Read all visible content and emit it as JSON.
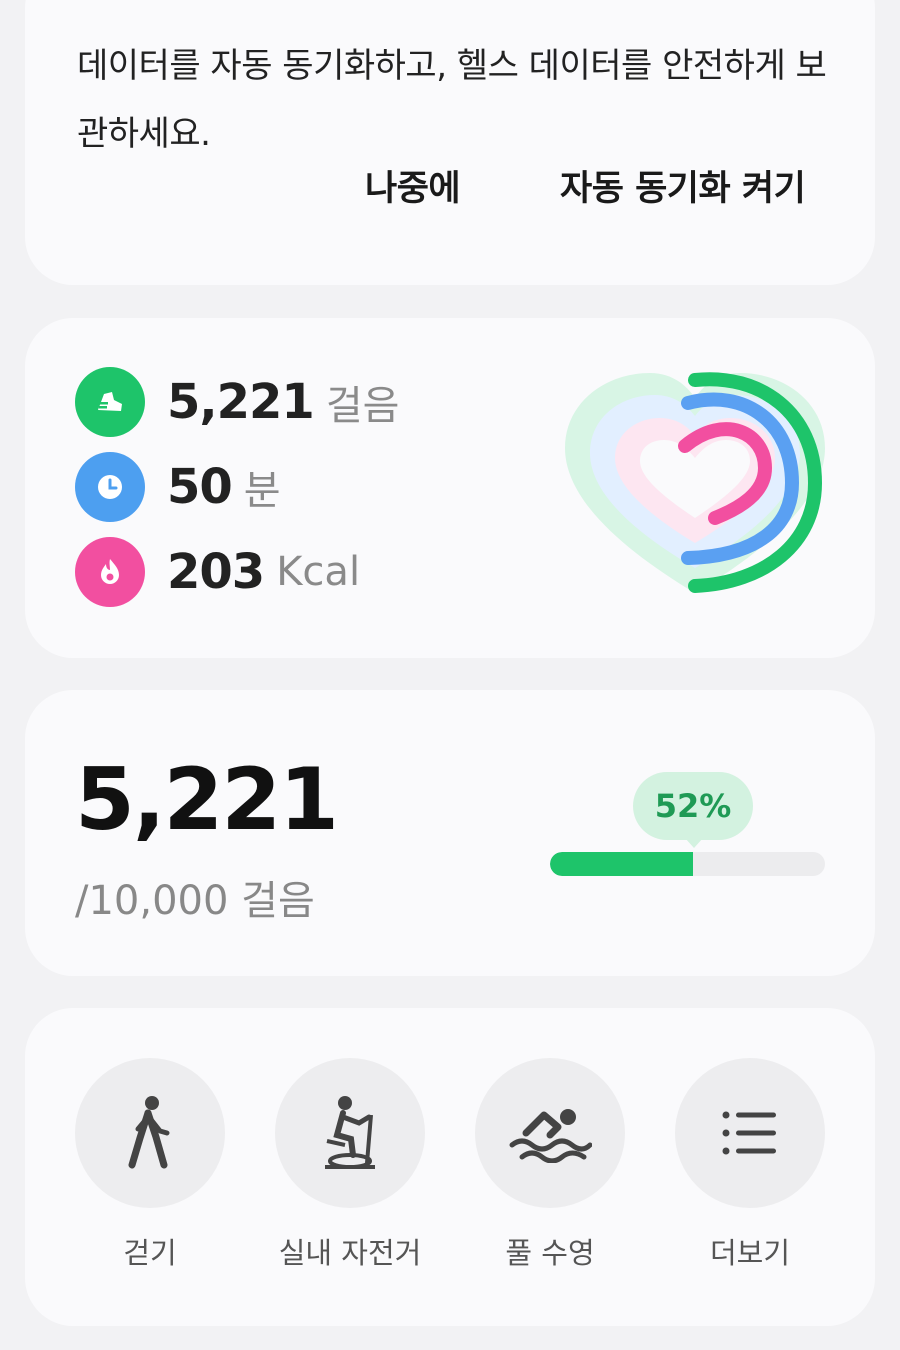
{
  "sync_prompt": {
    "message": "데이터를 자동 동기화하고, 헬스 데이터를 안전하게 보관하세요.",
    "later_label": "나중에",
    "enable_label": "자동 동기화 켜기"
  },
  "summary": {
    "steps": {
      "value": "5,221",
      "unit": "걸음",
      "icon": "shoe-icon",
      "color": "#1ec46a"
    },
    "active_time": {
      "value": "50",
      "unit": "분",
      "icon": "clock-icon",
      "color": "#4d9ff0"
    },
    "calories": {
      "value": "203",
      "unit": "Kcal",
      "icon": "flame-icon",
      "color": "#f24fa0"
    }
  },
  "step_goal": {
    "current": "5,221",
    "goal_text": "/10,000 걸음",
    "percent_label": "52%",
    "progress": 0.52,
    "color": "#1ec46a"
  },
  "workouts": [
    {
      "label": "걷기",
      "icon": "walking-icon"
    },
    {
      "label": "실내 자전거",
      "icon": "indoor-bike-icon"
    },
    {
      "label": "풀 수영",
      "icon": "swimming-icon"
    },
    {
      "label": "더보기",
      "icon": "list-icon"
    }
  ]
}
